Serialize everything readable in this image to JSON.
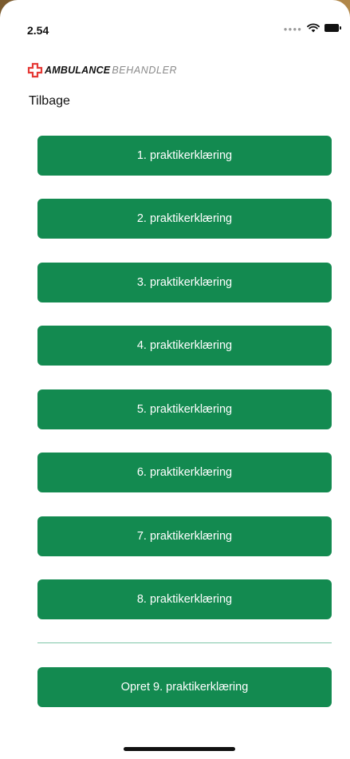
{
  "status_bar": {
    "time": "2.54",
    "signal_icon": "signal-dots-icon",
    "wifi_icon": "wifi-icon",
    "battery_icon": "battery-icon"
  },
  "logo": {
    "icon": "ambulance-cross-icon",
    "text_bold": "AMBULANCE",
    "text_light": "BEHANDLER",
    "accent_color": "#e53935"
  },
  "nav": {
    "back_label": "Tilbage"
  },
  "buttons": [
    {
      "label": "1. praktikerklæring"
    },
    {
      "label": "2. praktikerklæring"
    },
    {
      "label": "3. praktikerklæring"
    },
    {
      "label": "4. praktikerklæring"
    },
    {
      "label": "5. praktikerklæring"
    },
    {
      "label": "6. praktikerklæring"
    },
    {
      "label": "7. praktikerklæring"
    },
    {
      "label": "8. praktikerklæring"
    }
  ],
  "create_button": {
    "label": "Opret 9. praktikerklæring"
  },
  "colors": {
    "button_green": "#138a50",
    "divider": "#7fc6a8"
  }
}
